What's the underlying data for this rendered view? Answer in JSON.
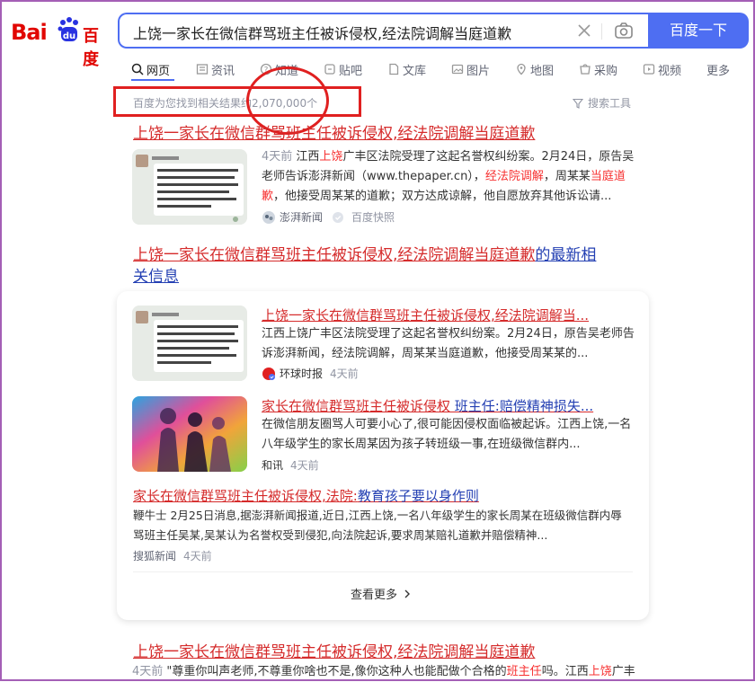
{
  "logo": {
    "left": "Bai",
    "right": "百度"
  },
  "search": {
    "query": "上饶一家长在微信群骂班主任被诉侵权,经法院调解当庭道歉",
    "button": "百度一下"
  },
  "tabs": [
    "网页",
    "资讯",
    "知道",
    "贴吧",
    "文库",
    "图片",
    "地图",
    "采购",
    "视频",
    "更多"
  ],
  "result_count": "百度为您找到相关结果约2,070,000个",
  "search_tools": "搜索工具",
  "results": [
    {
      "title": "上饶一家长在微信群骂班主任被诉侵权,经法院调解当庭道歉",
      "summary_a": "4天前",
      "summary_b": " 江西",
      "summary_c": "上饶",
      "summary_d": "广丰区法院受理了这起名誉权纠纷案。2月24日，原告吴",
      "summary_e": "老师告诉澎湃新闻（www.thepaper.cn），",
      "summary_f": "经法院调解",
      "summary_g": "，周某某",
      "summary_h": "当庭道",
      "summary_i": "歉",
      "summary_j": "，他接受周某某的道歉；双方达成谅解，他自愿放弃其他诉讼请...",
      "source": "澎湃新闻",
      "source2": "百度快照"
    }
  ],
  "news_block": {
    "title_red": "上饶一家长在微信群骂班主任被诉侵权,经法院调解当庭道歉",
    "title_blue_a": "的最新相",
    "title_blue_b": "关信息",
    "items": [
      {
        "title": "上饶一家长在微信群骂班主任被诉侵权,经法院调解当...",
        "summary1": "江西上饶广丰区法院受理了这起名誉权纠纷案。2月24日，原告吴老师告",
        "summary2": "诉澎湃新闻，经法院调解，周某某当庭道歉，他接受周某某的...",
        "source": "环球时报",
        "time": "4天前"
      },
      {
        "title_red": "家长在微信群骂班主任被诉侵权",
        "title_blue": " 班主任:赔偿精神损失...",
        "summary1": "在微信朋友圈骂人可要小心了,很可能因侵权面临被起诉。江西上饶,一名",
        "summary2": "八年级学生的家长周某因为孩子转班级一事,在班级微信群内...",
        "source": "和讯",
        "time": "4天前"
      },
      {
        "title_red": "家长在微信群骂班主任被诉侵权,法院:",
        "title_blue": "教育孩子要以身作则",
        "summary1": "鞭牛士 2月25日消息,据澎湃新闻报道,近日,江西上饶,一名八年级学生的家长周某在班级微信群内辱",
        "summary2": "骂班主任吴某,吴某认为名誉权受到侵犯,向法院起诉,要求周某赔礼道歉并赔偿精神...",
        "source": "搜狐新闻",
        "time": "4天前"
      }
    ],
    "more": "查看更多"
  },
  "result2": {
    "title": "上饶一家长在微信群骂班主任被诉侵权,经法院调解当庭道歉",
    "summary_a": "4天前",
    "summary_b": " \"尊重你叫声老师,不尊重你啥也不是,像你这种人也能配做个合格的",
    "summary_c": "班主任",
    "summary_d": "吗。江西",
    "summary_e": "上饶",
    "summary_f": "广丰"
  },
  "colors": {
    "accent": "#4e6ef2",
    "title_red": "#d52b2b",
    "link_blue": "#2440b3",
    "annotation_red": "#e02020"
  }
}
